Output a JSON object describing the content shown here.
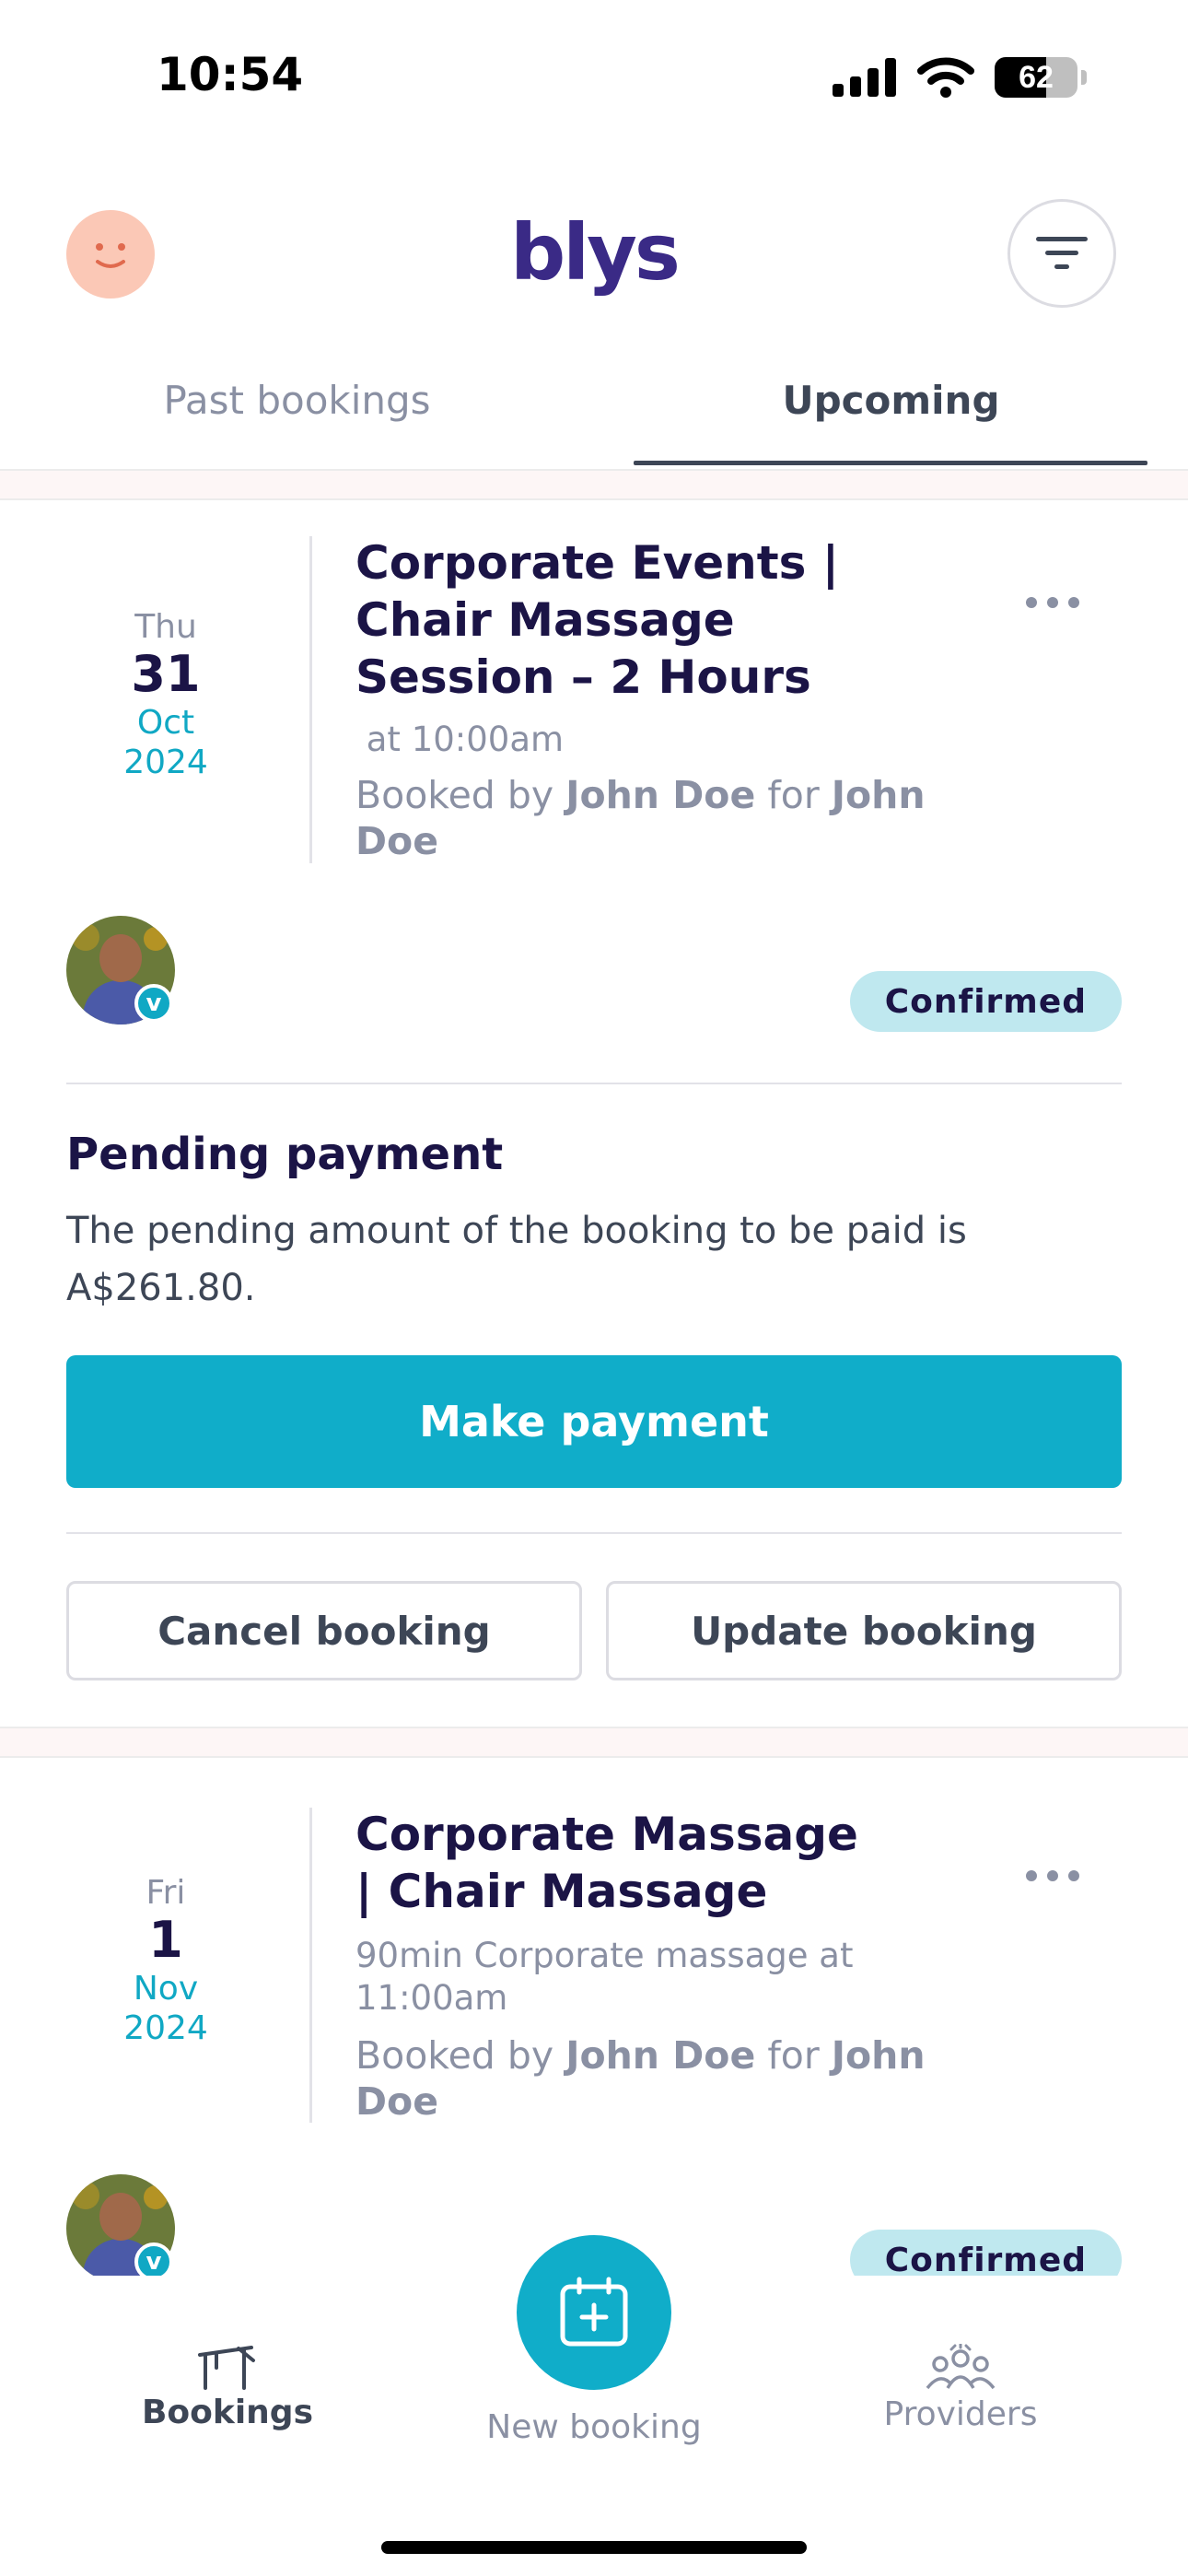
{
  "status_bar": {
    "time": "10:54",
    "battery": "62",
    "battery_level": 0.62
  },
  "header": {
    "logo": "blys"
  },
  "tabs": [
    {
      "label": "Past bookings",
      "active": false
    },
    {
      "label": "Upcoming",
      "active": true
    }
  ],
  "bookings": [
    {
      "dow": "Thu",
      "day": "31",
      "month": "Oct",
      "year": "2024",
      "title": "Corporate Events | Chair Massage Session – 2 Hours",
      "subtitle": " at 10:00am",
      "booked_by_prefix": "Booked by ",
      "booked_by": "John Doe",
      "for_text": " for ",
      "booked_for": "John Doe",
      "status": "Confirmed",
      "verified_badge": "v",
      "pending": {
        "title": "Pending payment",
        "text": "The pending amount of the booking to be paid is A$261.80.",
        "button": "Make payment"
      },
      "actions": {
        "cancel": "Cancel booking",
        "update": "Update booking"
      }
    },
    {
      "dow": "Fri",
      "day": "1",
      "month": "Nov",
      "year": "2024",
      "title": "Corporate Massage | Chair Massage",
      "subtitle": "90min Corporate massage at 11:00am",
      "booked_by_prefix": "Booked by ",
      "booked_by": "John Doe",
      "for_text": " for ",
      "booked_for": "John Doe",
      "status": "Confirmed",
      "verified_badge": "v"
    }
  ],
  "bottom_nav": [
    {
      "label": "Bookings",
      "icon": "bookings-icon",
      "active": true
    },
    {
      "label": "New booking",
      "icon": "calendar-plus-icon",
      "active": false
    },
    {
      "label": "Providers",
      "icon": "providers-icon",
      "active": false
    }
  ],
  "colors": {
    "accent": "#10adc9",
    "brand": "#3a2a86",
    "pill_bg": "#bfe8ef",
    "title": "#1b1446"
  }
}
